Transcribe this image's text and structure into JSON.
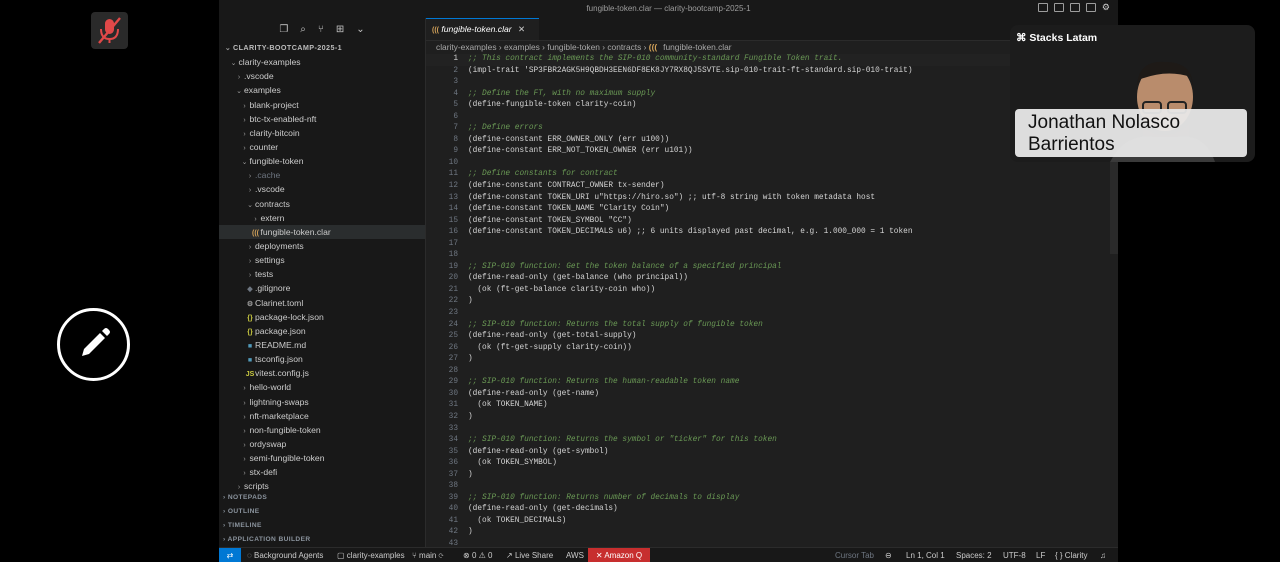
{
  "titlebar": {
    "title": "fungible-token.clar — clarity-bootcamp-2025-1"
  },
  "sidebar": {
    "root": "CLARITY-BOOTCAMP-2025-1",
    "items": [
      {
        "label": "clarity-examples",
        "depth": 1,
        "kind": "open"
      },
      {
        "label": ".vscode",
        "depth": 2,
        "kind": "closed"
      },
      {
        "label": "examples",
        "depth": 2,
        "kind": "open"
      },
      {
        "label": "blank-project",
        "depth": 3,
        "kind": "closed"
      },
      {
        "label": "btc-tx-enabled-nft",
        "depth": 3,
        "kind": "closed"
      },
      {
        "label": "clarity-bitcoin",
        "depth": 3,
        "kind": "closed"
      },
      {
        "label": "counter",
        "depth": 3,
        "kind": "closed"
      },
      {
        "label": "fungible-token",
        "depth": 3,
        "kind": "open"
      },
      {
        "label": ".cache",
        "depth": 4,
        "kind": "closed",
        "dim": true
      },
      {
        "label": ".vscode",
        "depth": 4,
        "kind": "closed"
      },
      {
        "label": "contracts",
        "depth": 4,
        "kind": "open"
      },
      {
        "label": "extern",
        "depth": 5,
        "kind": "closed"
      },
      {
        "label": "fungible-token.clar",
        "depth": 5,
        "kind": "file",
        "icon": "(((",
        "iconColor": "#d4a35a",
        "selected": true
      },
      {
        "label": "deployments",
        "depth": 4,
        "kind": "closed"
      },
      {
        "label": "settings",
        "depth": 4,
        "kind": "closed"
      },
      {
        "label": "tests",
        "depth": 4,
        "kind": "closed"
      },
      {
        "label": ".gitignore",
        "depth": 4,
        "kind": "file",
        "icon": "◆",
        "iconColor": "#6e7681"
      },
      {
        "label": "Clarinet.toml",
        "depth": 4,
        "kind": "file",
        "icon": "⚙",
        "iconColor": "#9d9d9d"
      },
      {
        "label": "package-lock.json",
        "depth": 4,
        "kind": "file",
        "icon": "{}",
        "iconColor": "#cbcb41"
      },
      {
        "label": "package.json",
        "depth": 4,
        "kind": "file",
        "icon": "{}",
        "iconColor": "#cbcb41"
      },
      {
        "label": "README.md",
        "depth": 4,
        "kind": "file",
        "icon": "■",
        "iconColor": "#519aba"
      },
      {
        "label": "tsconfig.json",
        "depth": 4,
        "kind": "file",
        "icon": "■",
        "iconColor": "#519aba"
      },
      {
        "label": "vitest.config.js",
        "depth": 4,
        "kind": "file",
        "icon": "JS",
        "iconColor": "#cbcb41"
      },
      {
        "label": "hello-world",
        "depth": 3,
        "kind": "closed"
      },
      {
        "label": "lightning-swaps",
        "depth": 3,
        "kind": "closed"
      },
      {
        "label": "nft-marketplace",
        "depth": 3,
        "kind": "closed"
      },
      {
        "label": "non-fungible-token",
        "depth": 3,
        "kind": "closed"
      },
      {
        "label": "ordyswap",
        "depth": 3,
        "kind": "closed"
      },
      {
        "label": "semi-fungible-token",
        "depth": 3,
        "kind": "closed"
      },
      {
        "label": "stx-defi",
        "depth": 3,
        "kind": "closed"
      },
      {
        "label": "scripts",
        "depth": 2,
        "kind": "closed"
      }
    ],
    "sections": [
      "NOTEPADS",
      "OUTLINE",
      "TIMELINE",
      "APPLICATION BUILDER"
    ]
  },
  "editor": {
    "tab_label": "fungible-token.clar",
    "tab_icon": "(((",
    "breadcrumbs": [
      "clarity-examples",
      "examples",
      "fungible-token",
      "contracts",
      "fungible-token.clar"
    ],
    "lines": [
      ";; This contract implements the SIP-010 community-standard Fungible Token trait.",
      "(impl-trait 'SP3FBR2AGK5H9QBDH3EEN6DF8EK8JY7RX8QJ5SVTE.sip-010-trait-ft-standard.sip-010-trait)",
      "",
      ";; Define the FT, with no maximum supply",
      "(define-fungible-token clarity-coin)",
      "",
      ";; Define errors",
      "(define-constant ERR_OWNER_ONLY (err u100))",
      "(define-constant ERR_NOT_TOKEN_OWNER (err u101))",
      "",
      ";; Define constants for contract",
      "(define-constant CONTRACT_OWNER tx-sender)",
      "(define-constant TOKEN_URI u\"https://hiro.so\") ;; utf-8 string with token metadata host",
      "(define-constant TOKEN_NAME \"Clarity Coin\")",
      "(define-constant TOKEN_SYMBOL \"CC\")",
      "(define-constant TOKEN_DECIMALS u6) ;; 6 units displayed past decimal, e.g. 1.000_000 = 1 token",
      "",
      "",
      ";; SIP-010 function: Get the token balance of a specified principal",
      "(define-read-only (get-balance (who principal))",
      "  (ok (ft-get-balance clarity-coin who))",
      ")",
      "",
      ";; SIP-010 function: Returns the total supply of fungible token",
      "(define-read-only (get-total-supply)",
      "  (ok (ft-get-supply clarity-coin))",
      ")",
      "",
      ";; SIP-010 function: Returns the human-readable token name",
      "(define-read-only (get-name)",
      "  (ok TOKEN_NAME)",
      ")",
      "",
      ";; SIP-010 function: Returns the symbol or \"ticker\" for this token",
      "(define-read-only (get-symbol)",
      "  (ok TOKEN_SYMBOL)",
      ")",
      "",
      ";; SIP-010 function: Returns number of decimals to display",
      "(define-read-only (get-decimals)",
      "  (ok TOKEN_DECIMALS)",
      ")",
      ""
    ]
  },
  "statusbar": {
    "background_agents": "Background Agents",
    "project": "clarity-examples",
    "branch": "main",
    "errors": "0",
    "warnings": "0",
    "live_share": "Live Share",
    "aws": "AWS",
    "amazon_q": "Amazon Q",
    "cursor_tab": "Cursor Tab",
    "position": "Ln 1, Col 1",
    "spaces": "Spaces: 2",
    "encoding": "UTF-8",
    "eol": "LF",
    "language": "Clarity"
  },
  "overlay": {
    "brand": "Stacks Latam",
    "name": "Jonathan Nolasco Barrientos"
  },
  "colors": {
    "accent": "#0078d4",
    "amazon_q": "#c72e2e",
    "comment": "#6a9955",
    "string": "#ce9178",
    "paren": "#ffd700"
  }
}
